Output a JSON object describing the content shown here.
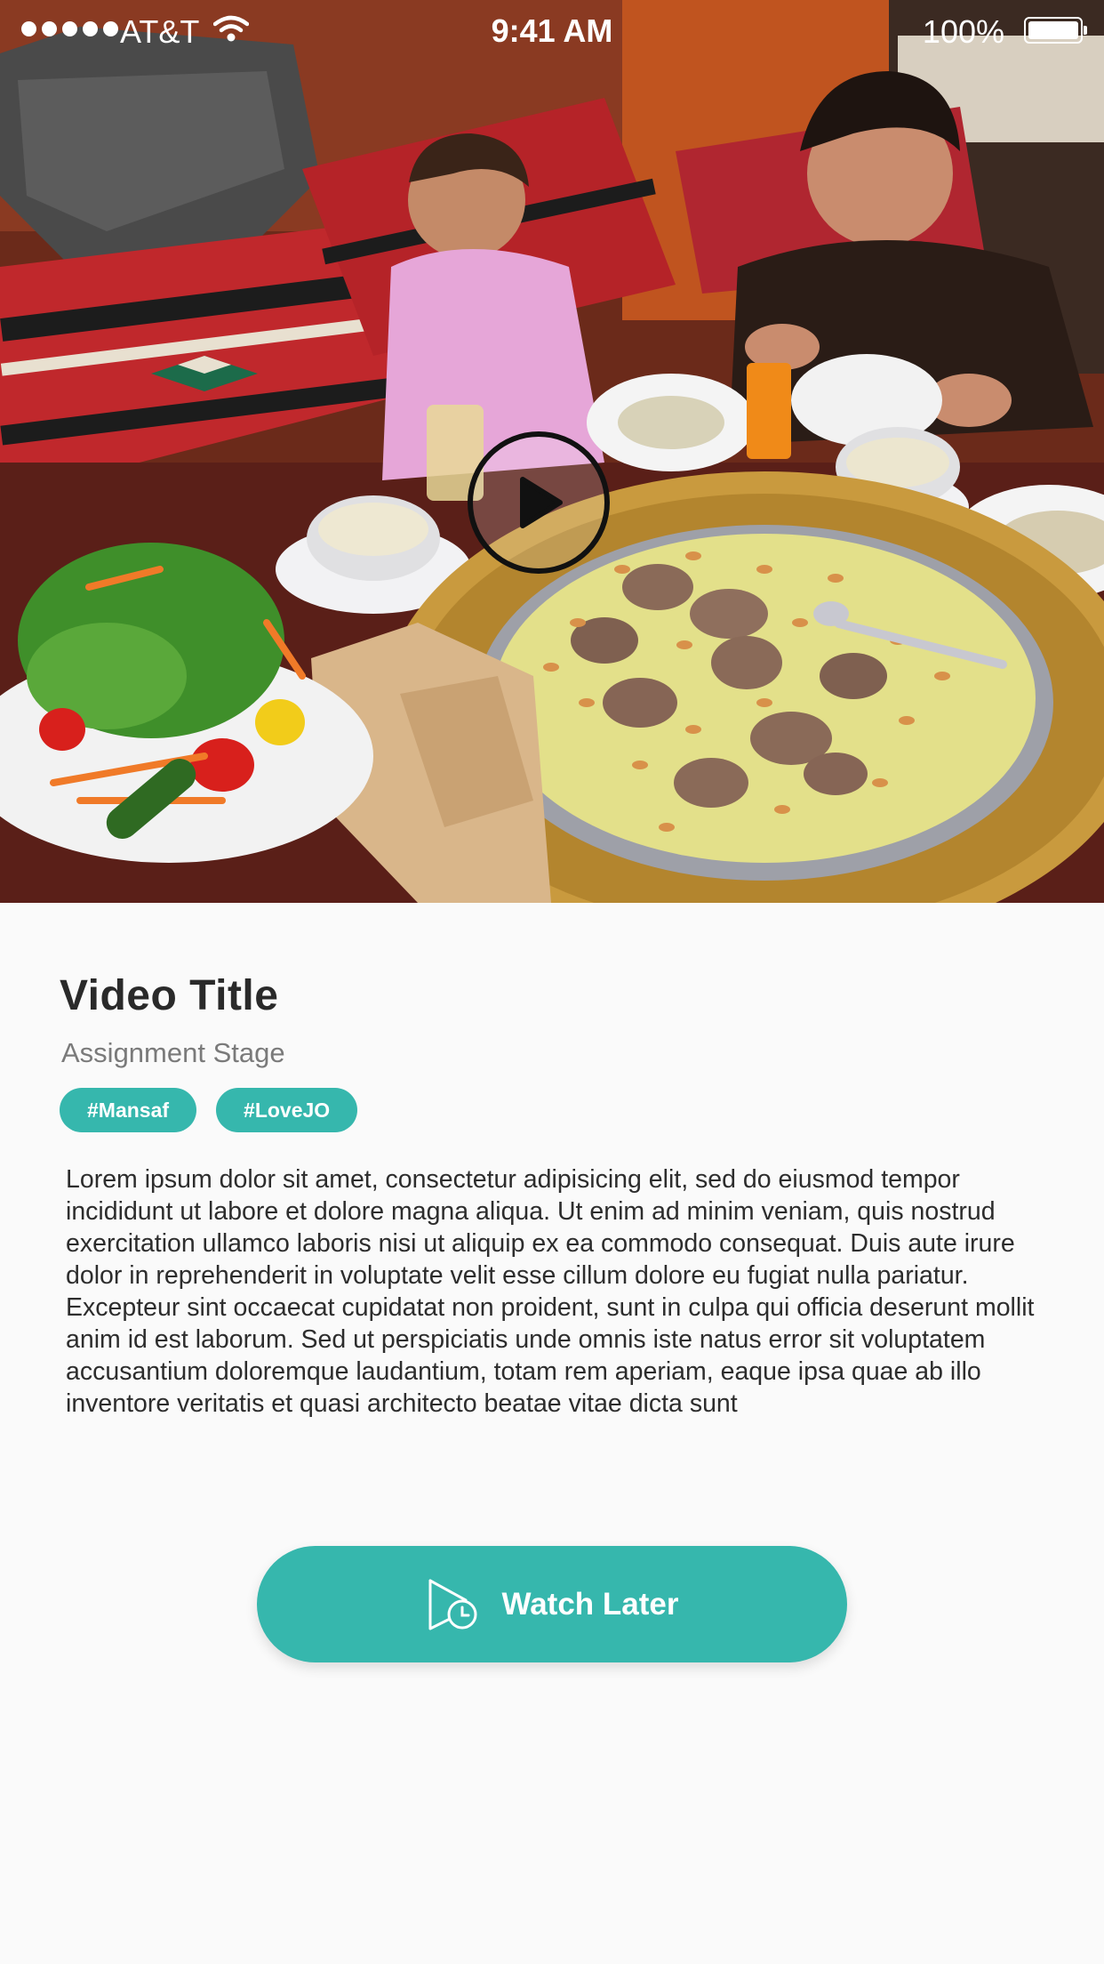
{
  "status_bar": {
    "carrier": "AT&T",
    "time": "9:41 AM",
    "battery": "100%"
  },
  "video": {
    "title": "Video Title",
    "subtitle": "Assignment Stage",
    "tags": [
      "#Mansaf",
      "#LoveJO"
    ],
    "description": "Lorem ipsum dolor sit amet, consectetur adipisicing elit, sed do eiusmod tempor incididunt ut labore et dolore magna aliqua. Ut enim ad minim veniam, quis nostrud exercitation ullamco laboris nisi ut aliquip ex ea commodo consequat. Duis aute irure dolor in reprehenderit in voluptate velit esse cillum dolore eu fugiat nulla pariatur. Excepteur sint occaecat cupidatat non proident, sunt in culpa qui officia deserunt mollit anim id est laborum. Sed ut perspiciatis unde omnis iste natus error sit voluptatem accusantium doloremque laudantium, totam rem aperiam, eaque ipsa quae ab illo inventore veritatis et quasi architecto beatae vitae dicta sunt"
  },
  "actions": {
    "watch_later_label": "Watch Later"
  },
  "icons": {
    "play": "play-icon",
    "watch_later": "watch-later-clock-icon",
    "wifi": "wifi-icon",
    "battery": "battery-icon"
  },
  "colors": {
    "accent": "#36b7ad",
    "background": "#fafafa",
    "title": "#2a2a2a",
    "subtitle": "#7a7a7a"
  }
}
